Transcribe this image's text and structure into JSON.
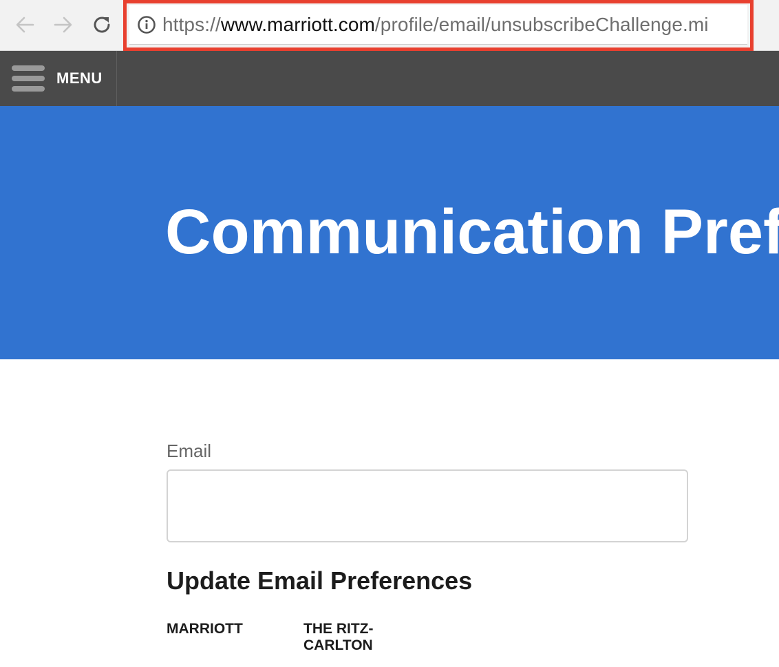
{
  "browser": {
    "url_scheme": "https://",
    "url_host": "www.marriott.com",
    "url_path": "/profile/email/unsubscribeChallenge.mi",
    "highlight_color": "#e8402f",
    "icons": [
      "back-arrow-icon",
      "forward-arrow-icon",
      "reload-icon",
      "info-icon"
    ]
  },
  "header": {
    "menu_label": "MENU",
    "background": "#4a4a4a"
  },
  "hero": {
    "title": "Communication Preferences",
    "background": "#3173d0"
  },
  "form": {
    "email_label": "Email",
    "email_value": "",
    "section_title": "Update Email Preferences",
    "brands": [
      {
        "label": "MARRIOTT"
      },
      {
        "label": "THE RITZ-CARLTON"
      }
    ]
  }
}
